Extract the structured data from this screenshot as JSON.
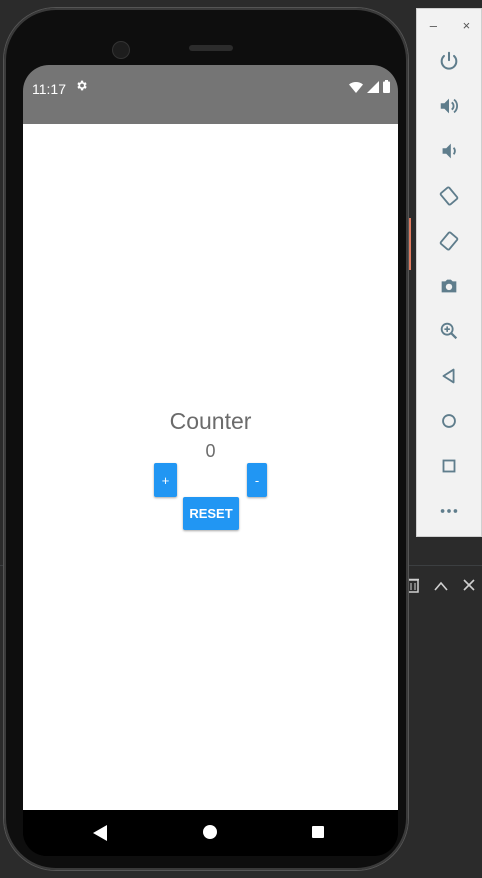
{
  "status_bar": {
    "time": "11:17",
    "settings_icon": "gear-icon",
    "icons": [
      "wifi-icon",
      "signal-icon",
      "battery-icon"
    ],
    "background": "#757575"
  },
  "app": {
    "title": "Counter",
    "count": "0",
    "buttons": {
      "increment": "+",
      "decrement": "-",
      "reset": "RESET"
    },
    "button_color": "#2196f3",
    "text_color": "#6b6b6b"
  },
  "nav_bar": {
    "items": [
      "back-icon",
      "home-icon",
      "recents-icon"
    ]
  },
  "emulator_toolbar": {
    "window_controls": {
      "minimize": "–",
      "close": "×"
    },
    "tools": [
      "power-icon",
      "volume-up-icon",
      "volume-down-icon",
      "rotate-left-icon",
      "rotate-right-icon",
      "camera-icon",
      "zoom-icon",
      "back-icon",
      "home-icon",
      "overview-icon",
      "more-icon"
    ],
    "icon_color": "#5f7d8c"
  },
  "ide_panel": {
    "tools": [
      "trash-icon",
      "chevron-up-icon",
      "close-icon"
    ]
  }
}
